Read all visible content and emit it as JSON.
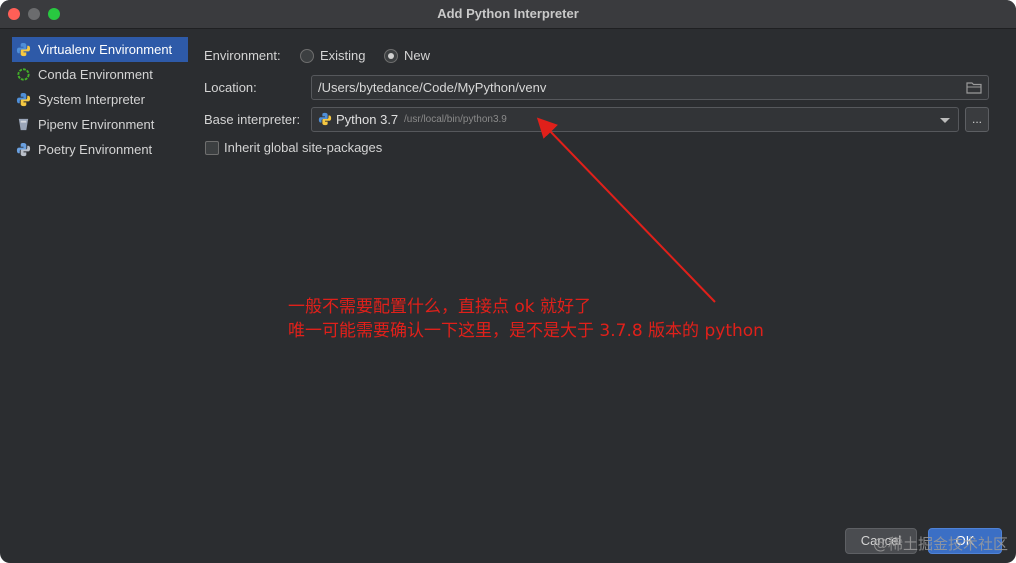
{
  "window": {
    "title": "Add Python Interpreter"
  },
  "sidebar": {
    "items": [
      {
        "label": "Virtualenv Environment",
        "icon": "python-icon",
        "selected": true
      },
      {
        "label": "Conda Environment",
        "icon": "conda-icon",
        "selected": false
      },
      {
        "label": "System Interpreter",
        "icon": "python-icon",
        "selected": false
      },
      {
        "label": "Pipenv Environment",
        "icon": "pipenv-icon",
        "selected": false
      },
      {
        "label": "Poetry Environment",
        "icon": "poetry-icon",
        "selected": false
      }
    ]
  },
  "form": {
    "environment_label": "Environment:",
    "option_existing": "Existing",
    "option_new": "New",
    "selected_option": "New",
    "location_label": "Location:",
    "location_value": "/Users/bytedance/Code/MyPython/venv",
    "base_label": "Base interpreter:",
    "base_version": "Python 3.7",
    "base_path": "/usr/local/bin/python3.9",
    "browse_label": "...",
    "inherit_label": "Inherit global site-packages",
    "inherit_checked": false
  },
  "annotation": {
    "line1": "一般不需要配置什么，直接点 ok 就好了",
    "line2": "唯一可能需要确认一下这里，是不是大于 3.7.8 版本的 python",
    "color": "#e0201a"
  },
  "buttons": {
    "cancel": "Cancel",
    "ok": "OK"
  },
  "watermark": "@稀土掘金技术社区",
  "colors": {
    "accent": "#2e5aa8",
    "ok_button": "#3b6fc5",
    "background": "#2b2d30"
  }
}
